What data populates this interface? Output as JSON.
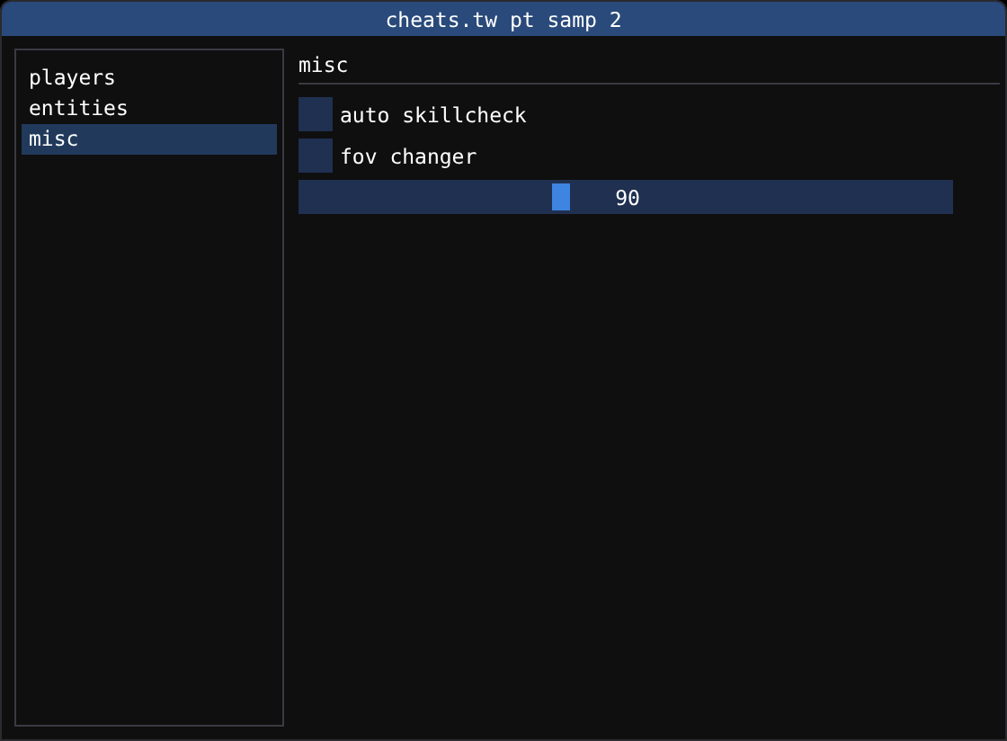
{
  "window": {
    "title": "cheats.tw pt samp 2"
  },
  "sidebar": {
    "items": [
      {
        "label": "players",
        "selected": false
      },
      {
        "label": "entities",
        "selected": false
      },
      {
        "label": "misc",
        "selected": true
      }
    ]
  },
  "section": {
    "title": "misc"
  },
  "controls": [
    {
      "kind": "checkbox",
      "label": "auto skillcheck",
      "checked": false
    },
    {
      "kind": "checkbox",
      "label": "fov changer",
      "checked": false
    },
    {
      "kind": "slider",
      "level": 0.4,
      "reading": "90"
    }
  ]
}
